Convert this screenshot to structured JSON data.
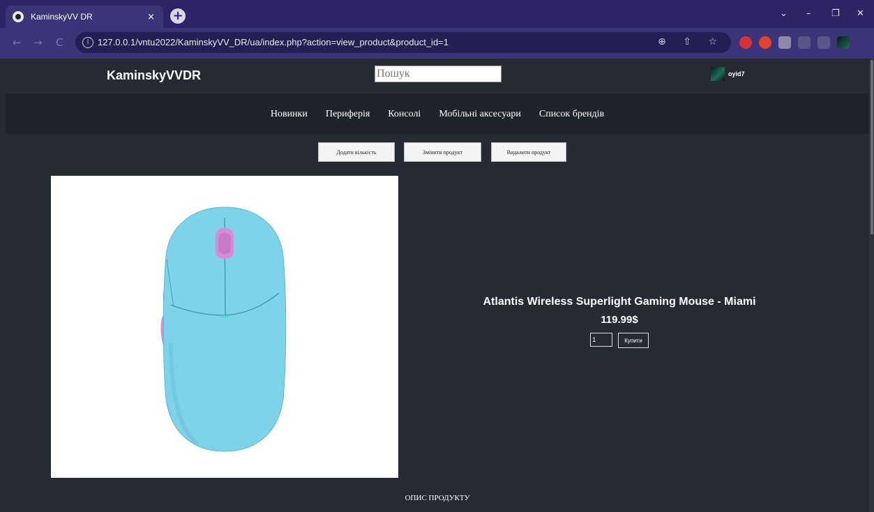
{
  "browser": {
    "tab_title": "KaminskyVV DR",
    "tab_close": "×",
    "new_tab": "+",
    "url": "127.0.0.1/vntu2022/KaminskyVV_DR/ua/index.php?action=view_product&product_id=1",
    "window_controls": {
      "minimize": "–",
      "restore": "❐",
      "close": "✕",
      "tabs": "⌄"
    },
    "nav": {
      "back": "←",
      "forward": "→",
      "reload": "C"
    },
    "omnibox_icons": "⊕ ⇧ ☆"
  },
  "site": {
    "brand": "KaminskyVVDR",
    "search_placeholder": "Пошук",
    "username": "oyid7",
    "nav": [
      "Новинки",
      "Периферія",
      "Консолі",
      "Мобільні аксесуари",
      "Список брендів"
    ]
  },
  "admin": {
    "add_quantity": "Додати кількість",
    "edit_product": "Змінити продукт",
    "delete_product": "Видалити продукт"
  },
  "product": {
    "title": "Atlantis Wireless Superlight Gaming Mouse - Miami",
    "price": "119.99$",
    "quantity": "1",
    "buy_label": "Купити",
    "image_icon": "gaming-mouse-image"
  },
  "description": {
    "heading": "ОПИС ПРОДУКТУ"
  },
  "colors": {
    "page_bg": "#262a33",
    "nav_bg": "#1f232a",
    "browser_frame": "#2c2464",
    "mouse_body": "#7fd3e8",
    "mouse_accent": "#d98ad9"
  }
}
